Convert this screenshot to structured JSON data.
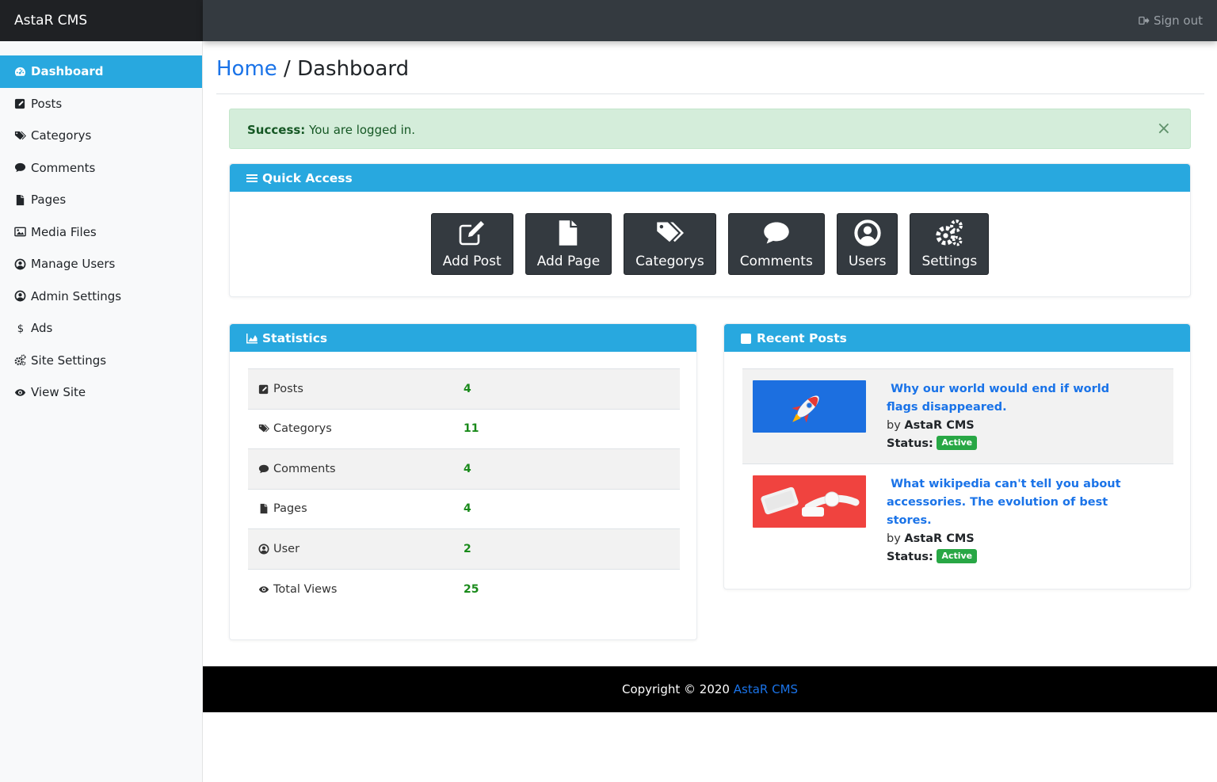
{
  "brand": "AstaR CMS",
  "header": {
    "signout_label": "Sign out"
  },
  "sidebar": {
    "items": [
      {
        "label": "Dashboard",
        "icon": "dashboard-icon",
        "active": true
      },
      {
        "label": "Posts",
        "icon": "edit-icon"
      },
      {
        "label": "Categorys",
        "icon": "tags-icon"
      },
      {
        "label": "Comments",
        "icon": "comment-icon"
      },
      {
        "label": "Pages",
        "icon": "file-icon"
      },
      {
        "label": "Media Files",
        "icon": "image-icon"
      },
      {
        "label": "Manage Users",
        "icon": "user-circle-icon"
      },
      {
        "label": "Admin Settings",
        "icon": "user-circle-icon"
      },
      {
        "label": "Ads",
        "icon": "dollar-icon"
      },
      {
        "label": "Site Settings",
        "icon": "cogs-icon"
      },
      {
        "label": "View Site",
        "icon": "eye-icon"
      }
    ]
  },
  "breadcrumb": {
    "home": "Home",
    "separator": " / ",
    "current": "Dashboard"
  },
  "alert": {
    "strong": "Success:",
    "text": " You are logged in.",
    "close": "×"
  },
  "quick_access": {
    "title": "Quick Access",
    "buttons": [
      {
        "label": "Add Post",
        "icon": "edit-icon"
      },
      {
        "label": "Add Page",
        "icon": "file-icon"
      },
      {
        "label": "Categorys",
        "icon": "tags-icon"
      },
      {
        "label": "Comments",
        "icon": "comment-icon"
      },
      {
        "label": "Users",
        "icon": "user-circle-icon"
      },
      {
        "label": "Settings",
        "icon": "cogs-icon"
      }
    ]
  },
  "statistics": {
    "title": "Statistics",
    "rows": [
      {
        "label": "Posts",
        "value": "4",
        "icon": "edit-icon"
      },
      {
        "label": "Categorys",
        "value": "11",
        "icon": "tags-icon"
      },
      {
        "label": "Comments",
        "value": "4",
        "icon": "comment-icon"
      },
      {
        "label": "Pages",
        "value": "4",
        "icon": "file-icon"
      },
      {
        "label": "User",
        "value": "2",
        "icon": "user-circle-icon"
      },
      {
        "label": "Total Views",
        "value": "25",
        "icon": "eye-icon"
      }
    ]
  },
  "recent_posts": {
    "title": "Recent Posts",
    "posts": [
      {
        "title": " Why our world would end if world flags disappeared.",
        "by": "by ",
        "author": "AstaR CMS",
        "status_label": "Status:",
        "status": "Active",
        "thumb_color": "#1c6fe0"
      },
      {
        "title": " What wikipedia can't tell you about accessories. The evolution of best stores.",
        "by": "by ",
        "author": "AstaR CMS",
        "status_label": "Status:",
        "status": "Active",
        "thumb_color": "#f0433f"
      }
    ]
  },
  "footer": {
    "text": "Copyright © 2020 ",
    "link": "AstaR CMS"
  }
}
